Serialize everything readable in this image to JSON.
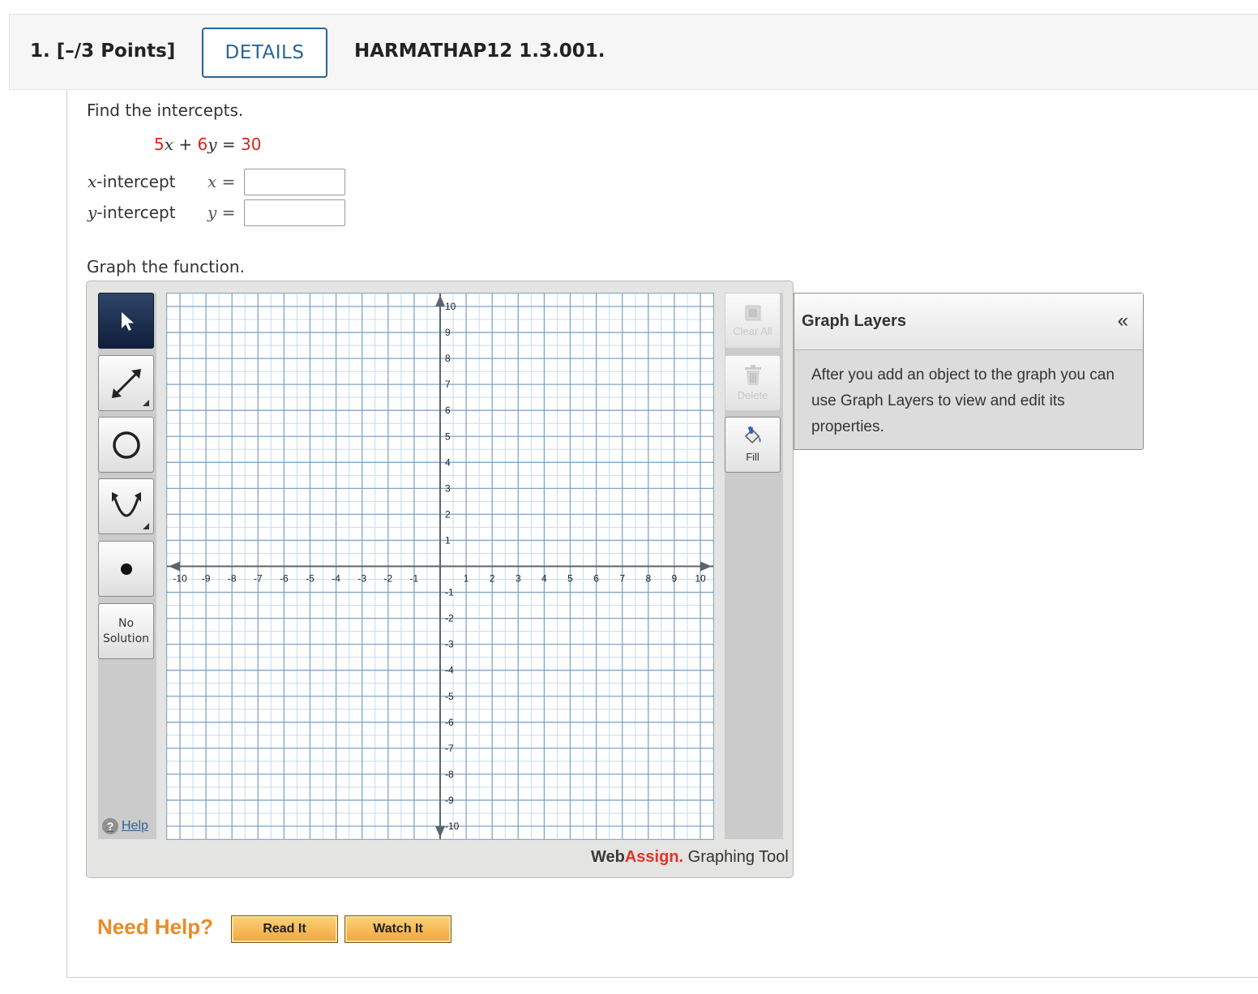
{
  "header": {
    "question_number": "1.",
    "points": "[–/3 Points]",
    "details_label": "DETAILS",
    "question_code": "HARMATHAP12 1.3.001."
  },
  "question": {
    "prompt": "Find the intercepts.",
    "equation": {
      "a": "5",
      "x": "x",
      "plus": "+",
      "b": "6",
      "y": "y",
      "equals": "=",
      "c": "30"
    },
    "x_intercept": {
      "label_var": "x",
      "label_text": "-intercept",
      "var": "x",
      "eq": "=",
      "value": ""
    },
    "y_intercept": {
      "label_var": "y",
      "label_text": "-intercept",
      "var": "y",
      "eq": "=",
      "value": ""
    },
    "graph_prompt": "Graph the function."
  },
  "graph_tool": {
    "tools": [
      {
        "name": "pointer",
        "icon": "pointer-arrow-icon",
        "active": true
      },
      {
        "name": "line",
        "icon": "line-tool-icon",
        "active": false
      },
      {
        "name": "circle",
        "icon": "circle-tool-icon",
        "active": false
      },
      {
        "name": "parabola",
        "icon": "parabola-tool-icon",
        "active": false
      },
      {
        "name": "point",
        "icon": "point-tool-icon",
        "active": false
      }
    ],
    "no_solution_label_1": "No",
    "no_solution_label_2": "Solution",
    "help_label": "Help",
    "clear_all_label": "Clear All",
    "delete_label": "Delete",
    "fill_label": "Fill",
    "brand_web": "Web",
    "brand_assign": "Assign.",
    "brand_suffix": " Graphing Tool",
    "grid": {
      "xlim": [
        -10,
        10
      ],
      "ylim": [
        -10,
        10
      ],
      "minor_step": 0.5,
      "x_ticks": [
        "-10",
        "-9",
        "-8",
        "-7",
        "-6",
        "-5",
        "-4",
        "-3",
        "-2",
        "-1",
        "1",
        "2",
        "3",
        "4",
        "5",
        "6",
        "7",
        "8",
        "9",
        "10"
      ],
      "y_ticks": [
        "10",
        "9",
        "8",
        "7",
        "6",
        "5",
        "4",
        "3",
        "2",
        "1",
        "-1",
        "-2",
        "-3",
        "-4",
        "-5",
        "-6",
        "-7",
        "-8",
        "-9",
        "-10"
      ]
    }
  },
  "graph_layers": {
    "title": "Graph Layers",
    "collapse_symbol": "«",
    "body": "After you add an object to the graph you can use Graph Layers to view and edit its properties."
  },
  "need_help": {
    "label": "Need Help?",
    "read_it": "Read It",
    "watch_it": "Watch It"
  },
  "colors": {
    "accent": "#2a6496",
    "equation_red": "#d8261b",
    "need_help_orange": "#e98b27",
    "grid_major": "#7ea6c9",
    "grid_minor": "#c8dcec",
    "axis": "#5a6570"
  }
}
